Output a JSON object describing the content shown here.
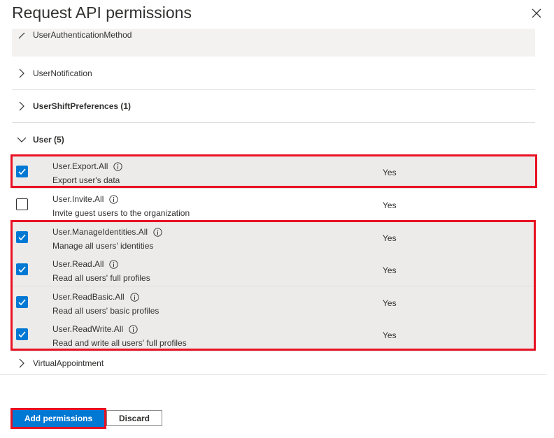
{
  "dialog": {
    "title": "Request API permissions"
  },
  "groups": {
    "partial": {
      "label": "UserAuthenticationMethod"
    },
    "notification": {
      "label": "UserNotification"
    },
    "shift": {
      "label": "UserShiftPreferences (1)"
    },
    "user": {
      "label": "User (5)"
    },
    "virtual": {
      "label": "VirtualAppointment"
    }
  },
  "permissions": [
    {
      "name": "User.Export.All",
      "description": "Export user's data",
      "admin_consent": "Yes",
      "checked": true
    },
    {
      "name": "User.Invite.All",
      "description": "Invite guest users to the organization",
      "admin_consent": "Yes",
      "checked": false
    },
    {
      "name": "User.ManageIdentities.All",
      "description": "Manage all users' identities",
      "admin_consent": "Yes",
      "checked": true
    },
    {
      "name": "User.Read.All",
      "description": "Read all users' full profiles",
      "admin_consent": "Yes",
      "checked": true
    },
    {
      "name": "User.ReadBasic.All",
      "description": "Read all users' basic profiles",
      "admin_consent": "Yes",
      "checked": true
    },
    {
      "name": "User.ReadWrite.All",
      "description": "Read and write all users' full profiles",
      "admin_consent": "Yes",
      "checked": true
    }
  ],
  "footer": {
    "add_label": "Add permissions",
    "discard_label": "Discard"
  },
  "colors": {
    "accent": "#0078d4",
    "highlight": "#e81123",
    "selected_row": "#edebe9"
  },
  "icons": {
    "close": "close-icon",
    "chevron_right": "chevron-right-icon",
    "chevron_down": "chevron-down-icon",
    "info": "info-icon",
    "check": "checkmark-icon"
  }
}
